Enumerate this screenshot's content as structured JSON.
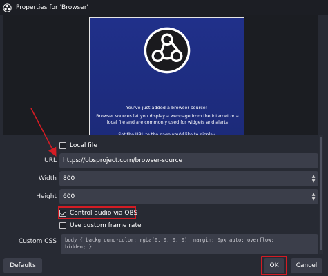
{
  "window": {
    "title": "Properties for 'Browser'"
  },
  "preview": {
    "heading": "You've just added a browser source!",
    "body": "Browser sources let you display a webpage from the internet or a local file and are commonly used for widgets and alerts",
    "footer": "Set the URL to the page you'd like to display",
    "logo_icon": "obs-logo"
  },
  "form": {
    "local_file": {
      "label": "Local file",
      "checked": false
    },
    "url": {
      "label": "URL",
      "value": "https://obsproject.com/browser-source"
    },
    "width": {
      "label": "Width",
      "value": "800"
    },
    "height": {
      "label": "Height",
      "value": "600"
    },
    "control_audio": {
      "label": "Control audio via OBS",
      "checked": true
    },
    "custom_frame_rate": {
      "label": "Use custom frame rate",
      "checked": false
    },
    "custom_css": {
      "label": "Custom CSS",
      "line1": "body { background-color: rgba(0, 0, 0, 0); margin: 0px auto; overflow:",
      "line2": "hidden; }"
    }
  },
  "buttons": {
    "defaults": "Defaults",
    "ok": "OK",
    "cancel": "Cancel"
  },
  "colors": {
    "background": "#272a33",
    "field": "#3b3e4a",
    "annotation_red": "#d31c24",
    "preview_blue": "#1e2a7a"
  }
}
